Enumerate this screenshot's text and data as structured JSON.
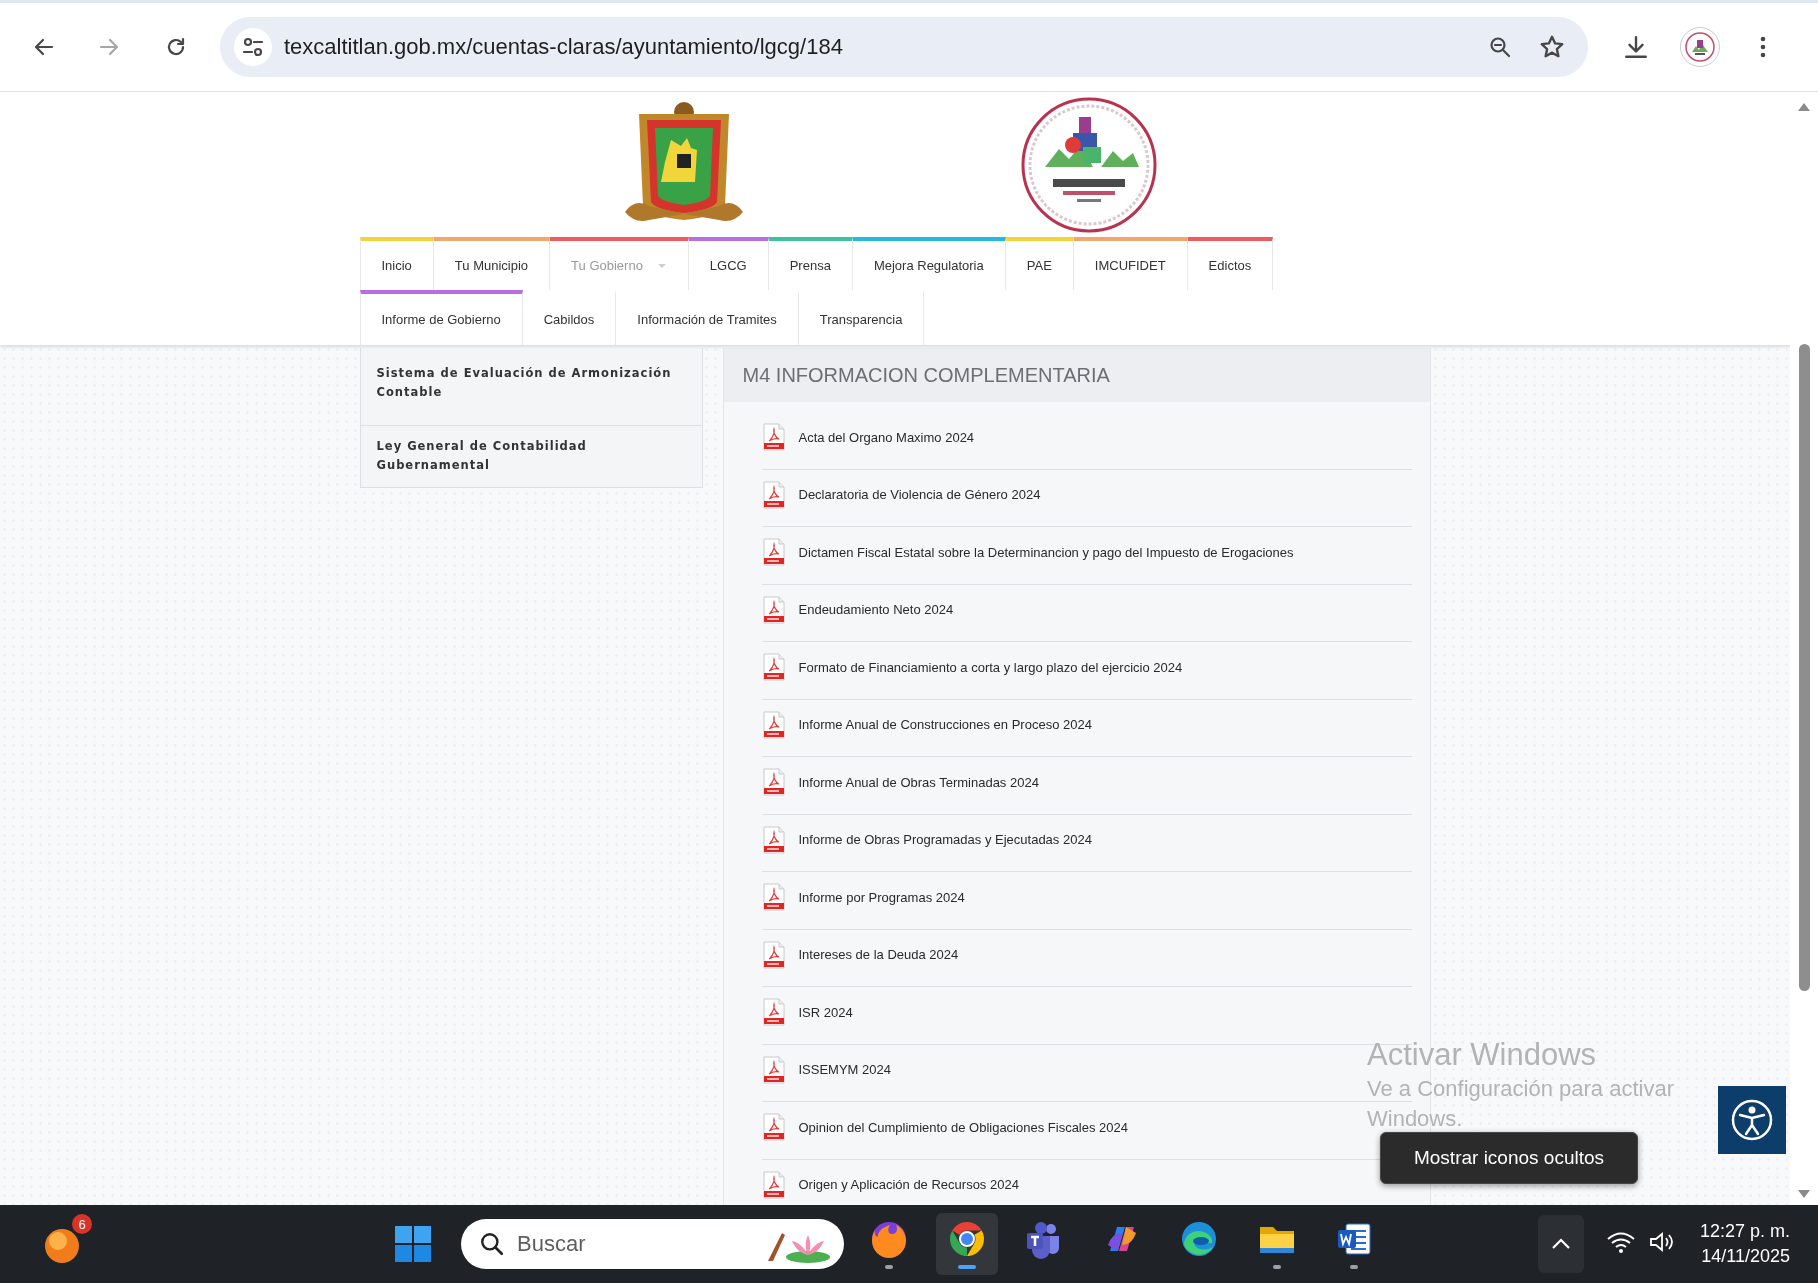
{
  "browser": {
    "url": "texcaltitlan.gob.mx/cuentas-claras/ayuntamiento/lgcg/184"
  },
  "site_header": {
    "nav_rows": [
      [
        {
          "label": "Inicio",
          "kind": "link",
          "color": "#f5d33b"
        },
        {
          "label": "Tu Municipio",
          "kind": "link",
          "color": "#f3a56b"
        },
        {
          "label": "Tu Gobierno",
          "kind": "dropdown",
          "color": "#ee5a63"
        },
        {
          "label": "LGCG",
          "kind": "link",
          "color": "#b56fe0"
        },
        {
          "label": "Prensa",
          "kind": "link",
          "color": "#3cc2a0"
        },
        {
          "label": "Mejora Regulatoria",
          "kind": "link",
          "color": "#25b9e0"
        },
        {
          "label": "PAE",
          "kind": "link",
          "color": "#f5d33b"
        },
        {
          "label": "IMCUFIDET",
          "kind": "link",
          "color": "#f3a56b"
        },
        {
          "label": "Edictos",
          "kind": "link",
          "color": "#ee5a63"
        }
      ],
      [
        {
          "label": "Informe de Gobierno",
          "kind": "link",
          "color": "#b56fe0"
        },
        {
          "label": "Cabildos",
          "kind": "link"
        },
        {
          "label": "Información de Tramites",
          "kind": "link"
        },
        {
          "label": "Transparencia",
          "kind": "link"
        }
      ]
    ]
  },
  "sidebar": {
    "items": [
      "Sistema de Evaluación de Armonización Contable",
      "Ley General de Contabilidad Gubernamental"
    ]
  },
  "panel": {
    "title": "M4 INFORMACION COMPLEMENTARIA",
    "documents": [
      "Acta del Organo Maximo 2024",
      "Declaratoria de Violencia de Género 2024",
      "Dictamen Fiscal Estatal sobre la Determinancion y pago del Impuesto de Erogaciones",
      "Endeudamiento Neto 2024",
      "Formato de Financiamiento a corta y largo plazo del ejercicio 2024",
      "Informe Anual de Construcciones en Proceso 2024",
      "Informe Anual de Obras Terminadas 2024",
      "Informe de Obras Programadas y Ejecutadas 2024",
      "Informe por Programas 2024",
      "Intereses de la Deuda 2024",
      "ISR 2024",
      "ISSEMYM 2024",
      "Opinion del Cumplimiento de Obligaciones Fiscales 2024",
      "Origen y Aplicación de Recursos 2024"
    ]
  },
  "activation_notice": {
    "title": "Activar Windows",
    "lines": [
      "Ve a Configuración para activar",
      "Windows."
    ]
  },
  "tooltip": "Mostrar iconos ocultos",
  "taskbar": {
    "widget_badge": "6",
    "search_placeholder": "Buscar",
    "apps": [
      {
        "kind": "firefox",
        "running": true,
        "selected": false
      },
      {
        "kind": "chrome",
        "running": true,
        "selected": true
      },
      {
        "kind": "teams",
        "running": false,
        "selected": false
      },
      {
        "kind": "copilot",
        "running": false,
        "selected": false
      },
      {
        "kind": "edge",
        "running": false,
        "selected": false
      },
      {
        "kind": "files",
        "running": true,
        "selected": false
      },
      {
        "kind": "word",
        "running": true,
        "selected": false
      }
    ],
    "time": "12:27 p. m.",
    "date": "14/11/2025"
  }
}
